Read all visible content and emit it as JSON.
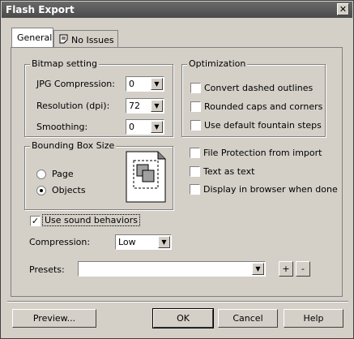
{
  "window": {
    "title": "Flash Export"
  },
  "tabs": [
    {
      "label": "General",
      "icon": ""
    },
    {
      "label": "No Issues",
      "icon": "checklist-icon"
    }
  ],
  "bitmap": {
    "title": "Bitmap setting",
    "jpg_label": "JPG Compression:",
    "jpg_value": "0",
    "res_label": "Resolution (dpi):",
    "res_value": "72",
    "smooth_label": "Smoothing:",
    "smooth_value": "0"
  },
  "optimization": {
    "title": "Optimization",
    "items": [
      {
        "label": "Convert dashed outlines",
        "checked": false
      },
      {
        "label": "Rounded caps and corners",
        "checked": false
      },
      {
        "label": "Use default fountain steps",
        "checked": false
      }
    ]
  },
  "bbox": {
    "title": "Bounding Box Size",
    "page_label": "Page",
    "objects_label": "Objects",
    "selected": "Objects"
  },
  "misc": {
    "items": [
      {
        "label": "File Protection from import",
        "checked": false
      },
      {
        "label": "Text as text",
        "checked": false
      },
      {
        "label": "Display in browser when done",
        "checked": false
      }
    ]
  },
  "sound": {
    "label": "Use sound behaviors",
    "checked": true
  },
  "compression": {
    "label": "Compression:",
    "value": "Low"
  },
  "presets": {
    "label": "Presets:",
    "value": "",
    "add": "+",
    "remove": "-"
  },
  "buttons": {
    "preview": "Preview...",
    "ok": "OK",
    "cancel": "Cancel",
    "help": "Help"
  }
}
